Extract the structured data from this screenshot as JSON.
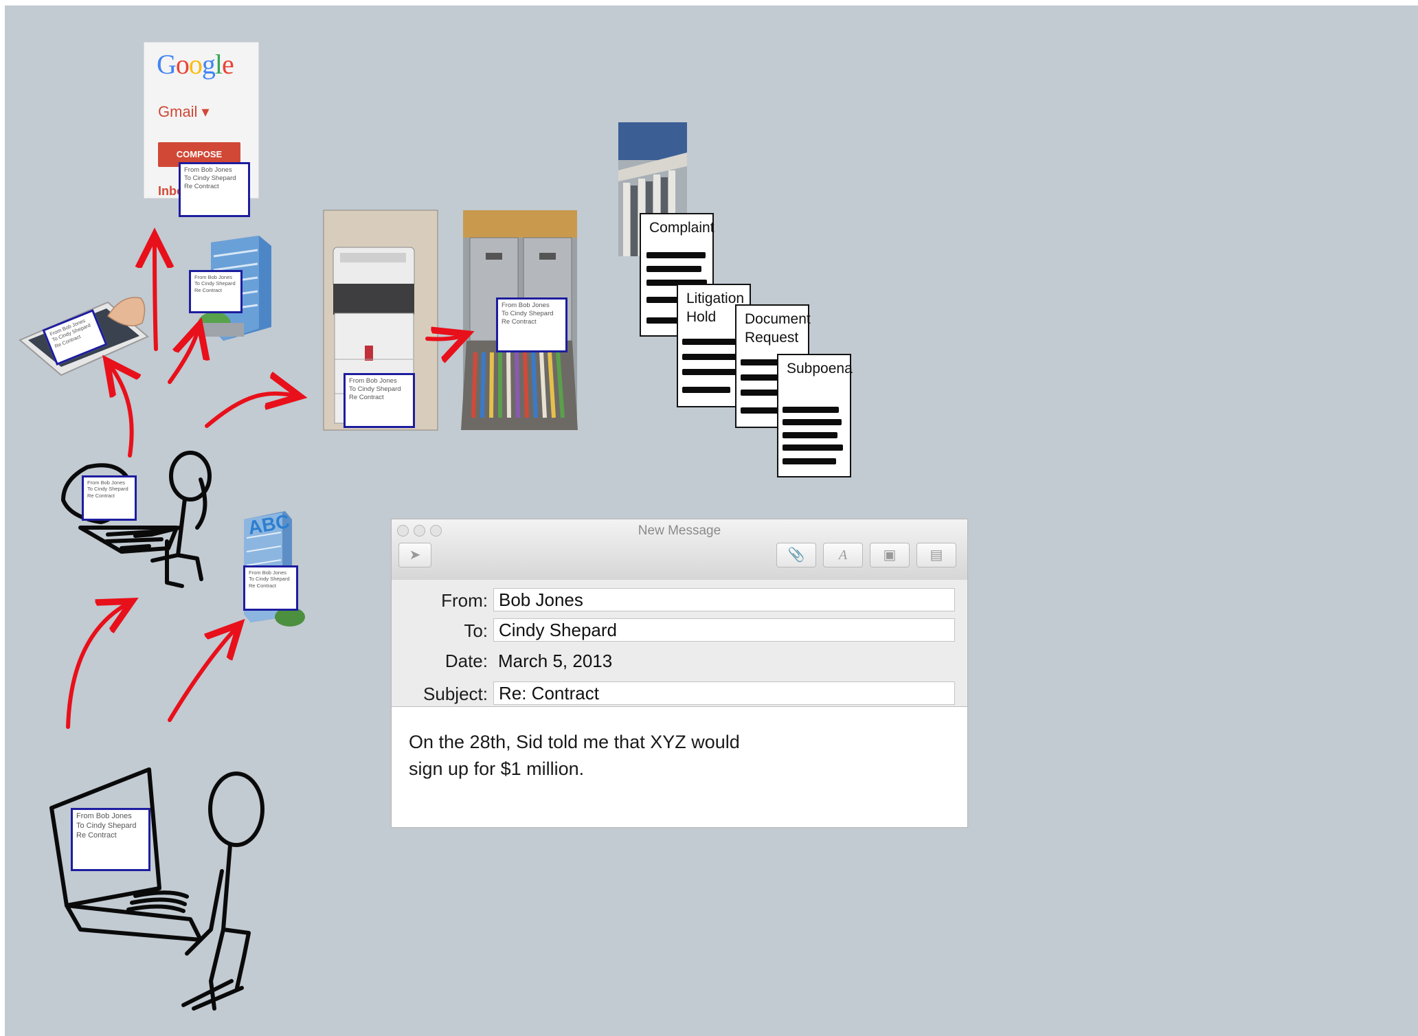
{
  "gmail": {
    "logo": "Google",
    "app_label": "Gmail ▾",
    "compose_label": "COMPOSE",
    "inbox_label": "Inbox",
    "logo_colors": [
      "#4285f4",
      "#ea4335",
      "#fbbc05",
      "#4285f4",
      "#34a853",
      "#ea4335"
    ]
  },
  "message_card": {
    "line1": "From Bob Jones",
    "line2": "To Cindy Shepard",
    "line3": "Re Contract"
  },
  "legal_documents": {
    "complaint": "Complaint",
    "litigation_hold_1": "Litigation",
    "litigation_hold_2": "Hold",
    "document_request_1": "Document",
    "document_request_2": "Request",
    "subpoena": "Subpoena"
  },
  "mail_window": {
    "title": "New Message",
    "from_label": "From:",
    "from_value": "Bob Jones",
    "to_label": "To:",
    "to_value": "Cindy Shepard",
    "date_label": "Date:",
    "date_value": "March 5, 2013",
    "subject_label": "Subject:",
    "subject_value": "Re: Contract",
    "body_line1": "On the 28th, Sid told me that XYZ would",
    "body_line2": "sign up for $1 million.",
    "toolbar_icons": [
      "send-icon",
      "attach-icon",
      "font-icon",
      "photo-icon",
      "template-icon"
    ]
  },
  "building_sign": "ABC",
  "colors": {
    "background": "#c2cad2",
    "arrow": "#e8101a",
    "card_border": "#1d1d9e",
    "gmail_red": "#d14836"
  }
}
